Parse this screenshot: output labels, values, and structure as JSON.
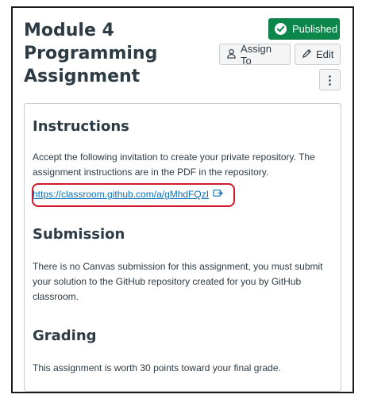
{
  "header": {
    "title": "Module 4 Programming Assignment",
    "published_label": "Published",
    "assign_to_label": "Assign To",
    "edit_label": "Edit",
    "more_label": "⋮"
  },
  "content": {
    "instructions": {
      "heading": "Instructions",
      "text": "Accept the following invitation to create your private repository. The assignment instructions are in the PDF in the repository.",
      "link_text": "https://classroom.github.com/a/gMhdFQzI"
    },
    "submission": {
      "heading": "Submission",
      "text": "There is no Canvas submission for this assignment, you must submit your solution to the GitHub repository created for you by GitHub classroom."
    },
    "grading": {
      "heading": "Grading",
      "text": "This assignment is worth 30 points toward your final grade."
    }
  },
  "colors": {
    "published_bg": "#0b874b",
    "link": "#0b6fb8",
    "highlight_box": "#d0192a"
  },
  "icons": [
    "check-icon",
    "user-icon",
    "pencil-icon",
    "kebab-menu-icon",
    "external-link-icon"
  ]
}
